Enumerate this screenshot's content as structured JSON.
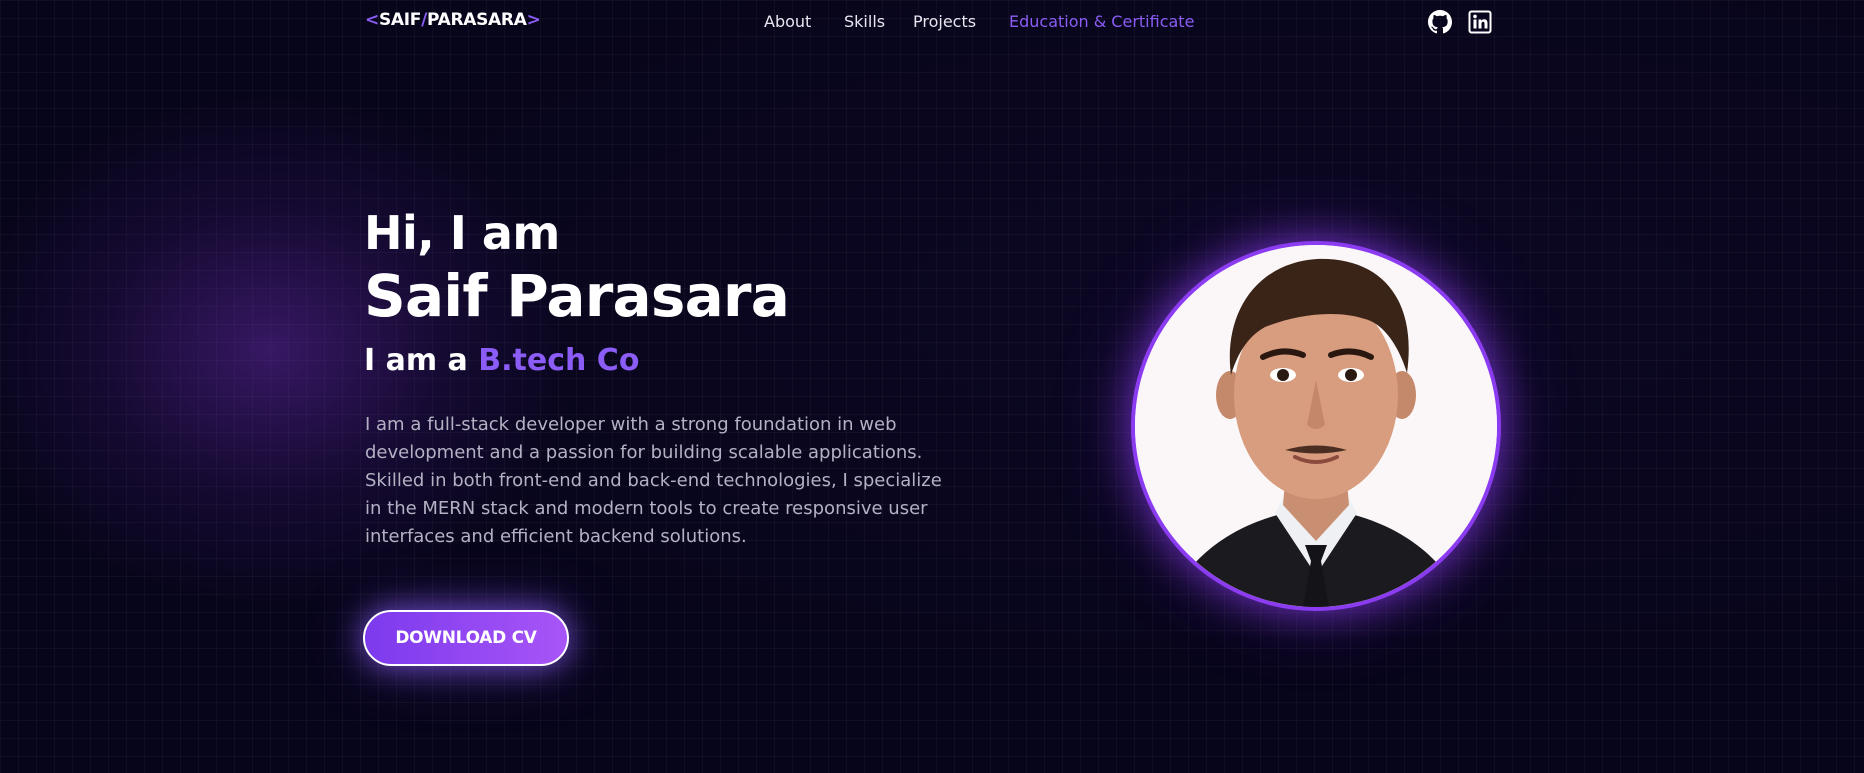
{
  "logo": {
    "lt": "<",
    "first": "SAIF",
    "slash": "/",
    "last": "PARASARA",
    "gt": ">"
  },
  "nav": {
    "items": [
      {
        "label": "About"
      },
      {
        "label": "Skills"
      },
      {
        "label": "Projects"
      },
      {
        "label": "Education & Certificate"
      }
    ],
    "social": [
      {
        "icon": "github-icon"
      },
      {
        "icon": "linkedin-icon"
      }
    ]
  },
  "hero": {
    "greeting": "Hi, I am",
    "name": "Saif Parasara",
    "role_prefix": "I am a",
    "role_highlight": "B.tech Co",
    "description": "I am a full-stack developer with a strong foundation in web development and a passion for building scalable applications. Skilled in both front-end and back-end technologies, I specialize in the MERN stack and modern tools to create responsive user interfaces and efficient backend solutions.",
    "cta_label": "DOWNLOAD CV"
  },
  "colors": {
    "accent": "#8b5cf6",
    "background": "#07051a"
  }
}
